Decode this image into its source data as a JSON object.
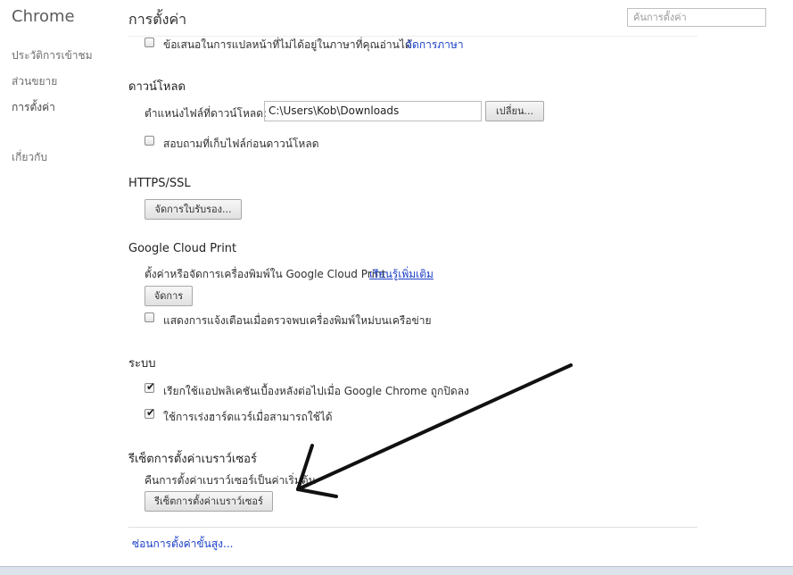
{
  "sidebar": {
    "brand": "Chrome",
    "items": [
      {
        "label": "ประวัติการเข้าชม"
      },
      {
        "label": "ส่วนขยาย"
      },
      {
        "label": "การตั้งค่า"
      },
      {
        "label": "เกี่ยวกับ"
      }
    ]
  },
  "header": {
    "title": "การตั้งค่า",
    "search_placeholder": "ค้นการตั้งค่า"
  },
  "translate": {
    "checkbox_label": "ข้อเสนอในการแปลหน้าที่ไม่ได้อยู่ในภาษาที่คุณอ่านได้",
    "manage_link": "จัดการภาษา"
  },
  "downloads": {
    "heading": "ดาวน์โหลด",
    "location_label": "ตำแหน่งไฟล์ที่ดาวน์โหลด:",
    "location_value": "C:\\Users\\Kob\\Downloads",
    "change_button": "เปลี่ยน...",
    "ask_checkbox": "สอบถามที่เก็บไฟล์ก่อนดาวน์โหลด"
  },
  "https": {
    "heading": "HTTPS/SSL",
    "manage_button": "จัดการใบรับรอง..."
  },
  "cloud_print": {
    "heading": "Google Cloud Print",
    "description": "ตั้งค่าหรือจัดการเครื่องพิมพ์ใน Google Cloud Print",
    "learn_more": "เรียนรู้เพิ่มเติม",
    "manage_button": "จัดการ",
    "notify_checkbox": "แสดงการแจ้งเตือนเมื่อตรวจพบเครื่องพิมพ์ใหม่บนเครือข่าย"
  },
  "system": {
    "heading": "ระบบ",
    "background_apps": "เรียกใช้แอปพลิเคชันเบื้องหลังต่อไปเมื่อ Google Chrome ถูกปิดลง",
    "hardware_accel": "ใช้การเร่งฮาร์ดแวร์เมื่อสามารถใช้ได้"
  },
  "reset": {
    "heading": "รีเซ็ตการตั้งค่าเบราว์เซอร์",
    "description": "คืนการตั้งค่าเบราว์เซอร์เป็นค่าเริ่มต้น",
    "button": "รีเซ็ตการตั้งค่าเบราว์เซอร์"
  },
  "footer": {
    "hide_advanced": "ซ่อนการตั้งค่าขั้นสูง..."
  },
  "checks": {
    "translate": false,
    "ask_download": false,
    "cloud_notify": false,
    "background_apps": true,
    "hardware_accel": true
  }
}
